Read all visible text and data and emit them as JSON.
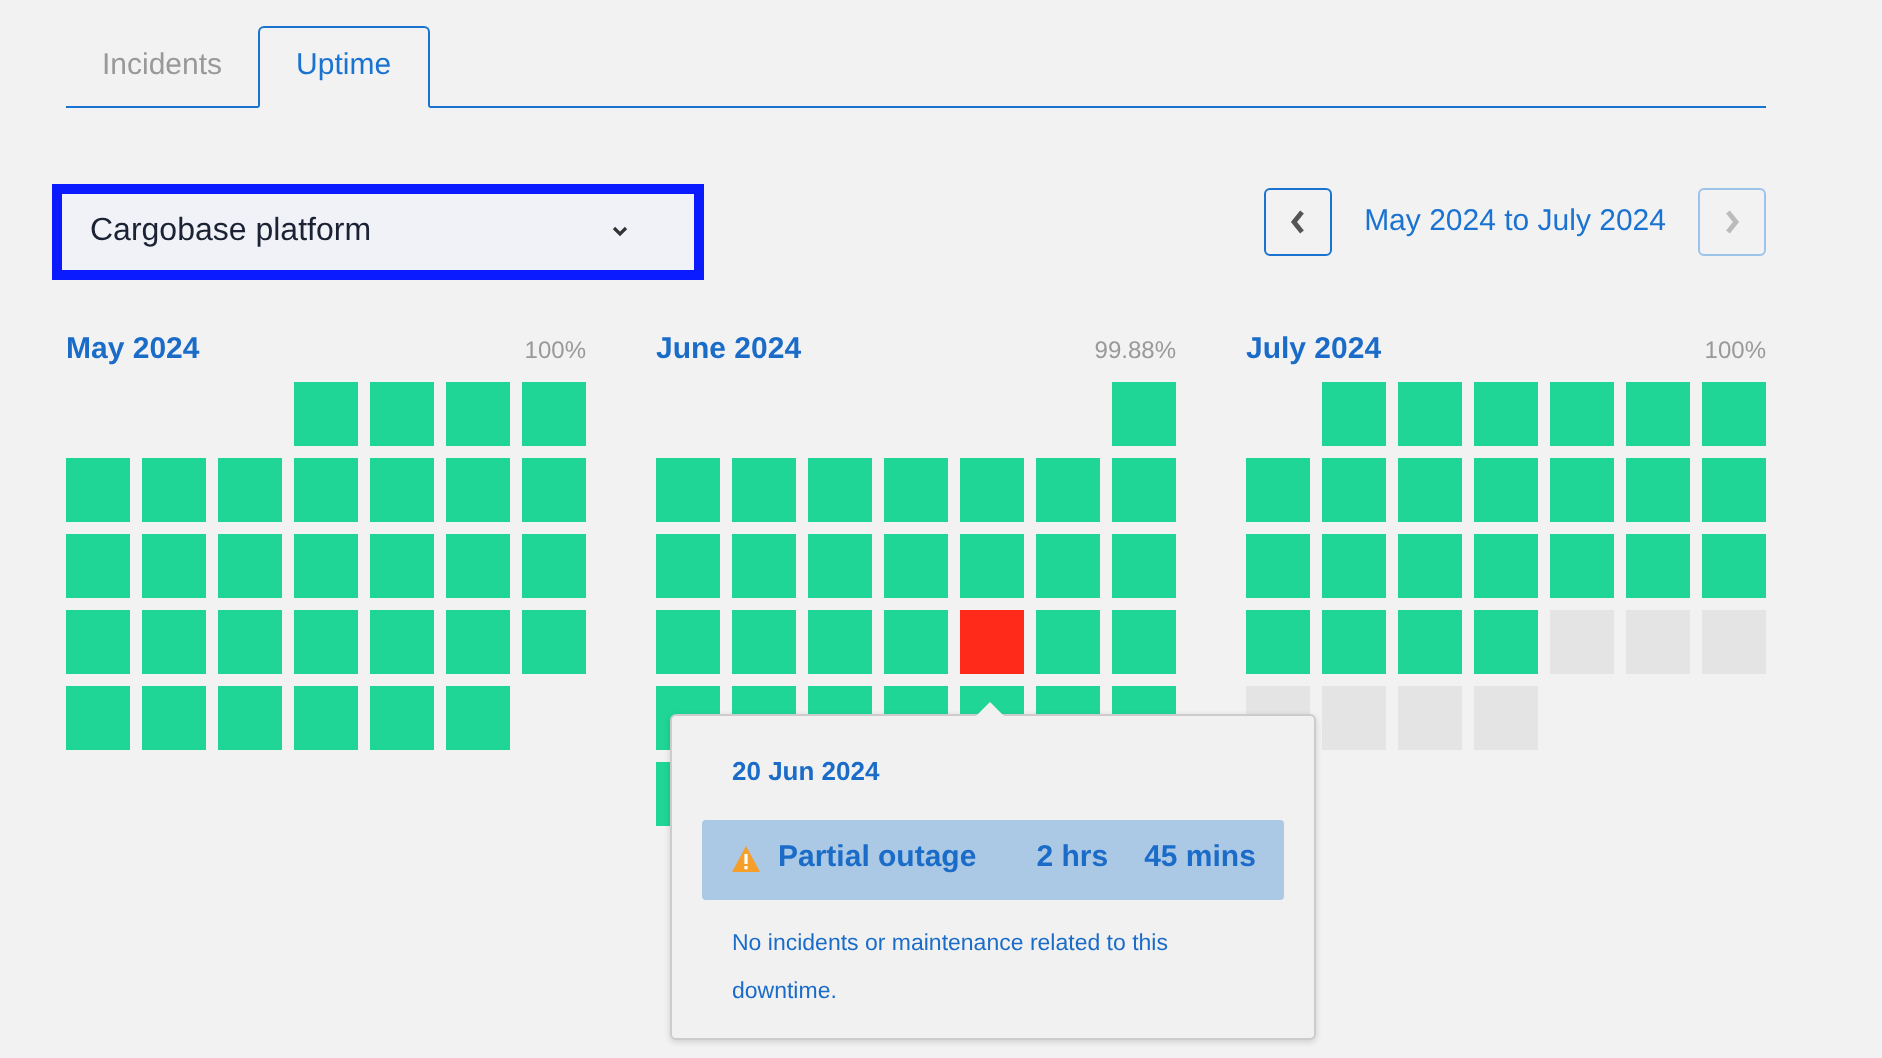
{
  "tabs": [
    {
      "label": "Incidents",
      "selected": false
    },
    {
      "label": "Uptime",
      "selected": true
    }
  ],
  "component_select": {
    "value": "Cargobase platform",
    "focused": true
  },
  "range": {
    "label": "May 2024 to July 2024",
    "prev_disabled": false,
    "next_disabled": true
  },
  "months": [
    {
      "name": "May 2024",
      "uptime": "100%",
      "days": [
        {
          "kind": "blank"
        },
        {
          "kind": "blank"
        },
        {
          "kind": "blank"
        },
        {
          "kind": "up"
        },
        {
          "kind": "up"
        },
        {
          "kind": "up"
        },
        {
          "kind": "up"
        },
        {
          "kind": "up"
        },
        {
          "kind": "up"
        },
        {
          "kind": "up"
        },
        {
          "kind": "up"
        },
        {
          "kind": "up"
        },
        {
          "kind": "up"
        },
        {
          "kind": "up"
        },
        {
          "kind": "up"
        },
        {
          "kind": "up"
        },
        {
          "kind": "up"
        },
        {
          "kind": "up"
        },
        {
          "kind": "up"
        },
        {
          "kind": "up"
        },
        {
          "kind": "up"
        },
        {
          "kind": "up"
        },
        {
          "kind": "up"
        },
        {
          "kind": "up"
        },
        {
          "kind": "up"
        },
        {
          "kind": "up"
        },
        {
          "kind": "up"
        },
        {
          "kind": "up"
        },
        {
          "kind": "up"
        },
        {
          "kind": "up"
        },
        {
          "kind": "up"
        },
        {
          "kind": "up"
        },
        {
          "kind": "up"
        },
        {
          "kind": "up"
        }
      ]
    },
    {
      "name": "June 2024",
      "uptime": "99.88%",
      "days": [
        {
          "kind": "blank"
        },
        {
          "kind": "blank"
        },
        {
          "kind": "blank"
        },
        {
          "kind": "blank"
        },
        {
          "kind": "blank"
        },
        {
          "kind": "blank"
        },
        {
          "kind": "up"
        },
        {
          "kind": "up"
        },
        {
          "kind": "up"
        },
        {
          "kind": "up"
        },
        {
          "kind": "up"
        },
        {
          "kind": "up"
        },
        {
          "kind": "up"
        },
        {
          "kind": "up"
        },
        {
          "kind": "up"
        },
        {
          "kind": "up"
        },
        {
          "kind": "up"
        },
        {
          "kind": "up"
        },
        {
          "kind": "up"
        },
        {
          "kind": "up"
        },
        {
          "kind": "up"
        },
        {
          "kind": "up"
        },
        {
          "kind": "up"
        },
        {
          "kind": "up"
        },
        {
          "kind": "up"
        },
        {
          "kind": "outage"
        },
        {
          "kind": "up"
        },
        {
          "kind": "up"
        },
        {
          "kind": "up"
        },
        {
          "kind": "up"
        },
        {
          "kind": "up"
        },
        {
          "kind": "up"
        },
        {
          "kind": "up"
        },
        {
          "kind": "up"
        },
        {
          "kind": "up"
        },
        {
          "kind": "up"
        }
      ]
    },
    {
      "name": "July 2024",
      "uptime": "100%",
      "days": [
        {
          "kind": "blank"
        },
        {
          "kind": "up"
        },
        {
          "kind": "up"
        },
        {
          "kind": "up"
        },
        {
          "kind": "up"
        },
        {
          "kind": "up"
        },
        {
          "kind": "up"
        },
        {
          "kind": "up"
        },
        {
          "kind": "up"
        },
        {
          "kind": "up"
        },
        {
          "kind": "up"
        },
        {
          "kind": "up"
        },
        {
          "kind": "up"
        },
        {
          "kind": "up"
        },
        {
          "kind": "up"
        },
        {
          "kind": "up"
        },
        {
          "kind": "up"
        },
        {
          "kind": "up"
        },
        {
          "kind": "up"
        },
        {
          "kind": "up"
        },
        {
          "kind": "up"
        },
        {
          "kind": "up"
        },
        {
          "kind": "up"
        },
        {
          "kind": "up"
        },
        {
          "kind": "up"
        },
        {
          "kind": "future"
        },
        {
          "kind": "future"
        },
        {
          "kind": "future"
        },
        {
          "kind": "future"
        },
        {
          "kind": "future"
        },
        {
          "kind": "future"
        },
        {
          "kind": "future"
        }
      ]
    }
  ],
  "tooltip": {
    "date": "20 Jun 2024",
    "status": "Partial outage",
    "hours": "2 hrs",
    "minutes": "45 mins",
    "note": "No incidents or maintenance related to this downtime."
  }
}
